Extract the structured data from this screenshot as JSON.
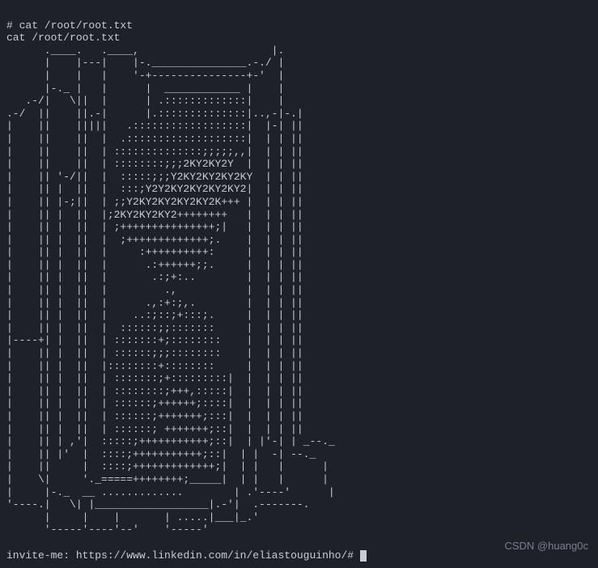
{
  "terminal": {
    "command_prompt": "# cat /root/root.txt",
    "command_echo": "cat /root/root.txt",
    "ascii_art": "      .____.   .____,                     |.\n      |    |---|    |-._______________.-./ |\n      |    |   |    '-+---------------+-'  |\n      |-._ |   |      |  ____________ |    |\n   .-/|   \\||  |      | .:::::::::::::|    |\n.-/  ||    ||.-|      |.::::::::::::::|..,-|-.|\n|    ||    |||||   .::::::::::::::::::|  |-| ||\n|    ||    ||  |  .:::::::::::::::::::|  | | ||\n|    ||    ||  | ::::::::::::::;;;;;,,|  | | ||\n|    ||    ||  | ::::::::;;;2KY2KY2Y  |  | | ||\n|    || '-/||  |  :::::;;;Y2KY2KY2KY2KY  | | ||\n|    || |  ||  |  :::;Y2Y2KY2KY2KY2KY2|  | | ||\n|    || |-;||  | ;;Y2KY2KY2KY2KY2K+++ |  | | ||\n|    || |  ||  |;2KY2KY2KY2++++++++   |  | | ||\n|    || |  ||  | ;+++++++++++++++;|   |  | | ||\n|    || |  ||  |  ;+++++++++++++;.    |  | | ||\n|    || |  ||  |     :++++++++++:     |  | | ||\n|    || |  ||  |      .:++++++;;.     |  | | ||\n|    || |  ||  |       .:;+:..        |  | | ||\n|    || |  ||  |         .,           |  | | ||\n|    || |  ||  |      .,:+:;,.        |  | | ||\n|    || |  ||  |    ..:;::;+:::;.     |  | | ||\n|    || |  ||  |  ::::::;;:::::::     |  | | ||\n|----+| |  ||  | :::::::+;::::::::    |  | | ||\n|    || |  ||  | ::::::;;;::::::::    |  | | ||\n|    || |  ||  |::::::::+::::::::     |  | | ||\n|    || |  ||  | :::::::;+:::::::::|  |  | | ||\n|    || |  ||  | ::::::::;+++,:::::|  |  | | ||\n|    || |  ||  | ::::::;++++++;::::|  |  | | ||\n|    || |  ||  | ::::::;+++++++;:::|  |  | | ||\n|    || |  ||  | ::::::; +++++++;::|  |  | | ||\n|    || | ,'|  :::::;+++++++++++;::|  | |'-| | _--._\n|    || |'  |  ::::;+++++++++++;::|  | |  -| --._\n|    ||     |  ::::;+++++++++++++;|  | |   |      |\n|    \\|     '._=====++++++++;_____|  | |   |      |\n|     |-._  __ .............        | .'----'      |\n'----.|   \\| |__________________|.-'|  .-------.\n      |     |    |       | .....|___|_.'\n      '-----'----'--'    '-----'",
    "invite_prefix": "invite-me: ",
    "invite_url": "https://www.linkedin.com/in/eliastouguinho/#"
  },
  "watermark": "CSDN @huang0c"
}
